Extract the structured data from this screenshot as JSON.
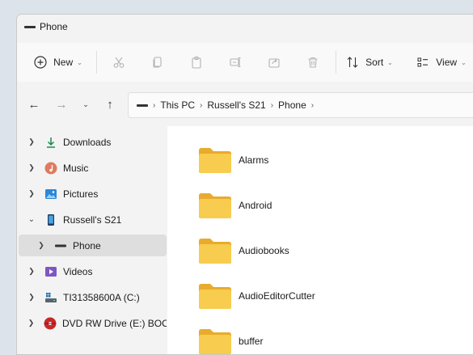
{
  "window": {
    "title": "Phone"
  },
  "toolbar": {
    "new_label": "New",
    "sort_label": "Sort",
    "view_label": "View",
    "buttons": [
      "new",
      "cut",
      "copy",
      "paste",
      "rename",
      "share",
      "delete",
      "sort",
      "view"
    ]
  },
  "address": {
    "crumbs": [
      "This PC",
      "Russell's S21",
      "Phone"
    ]
  },
  "sidebar": {
    "items": [
      {
        "label": "Downloads",
        "icon": "download-icon",
        "expanded": false
      },
      {
        "label": "Music",
        "icon": "music-icon",
        "expanded": false
      },
      {
        "label": "Pictures",
        "icon": "pictures-icon",
        "expanded": false
      },
      {
        "label": "Russell's S21",
        "icon": "phone-device-icon",
        "expanded": true
      },
      {
        "label": "Phone",
        "icon": "phone-storage-icon",
        "expanded": false,
        "selected": true
      },
      {
        "label": "Videos",
        "icon": "videos-icon",
        "expanded": false
      },
      {
        "label": "TI31358600A (C:)",
        "icon": "drive-icon",
        "expanded": false
      },
      {
        "label": "DVD RW Drive (E:) BOOK",
        "icon": "dvd-icon",
        "expanded": false
      }
    ]
  },
  "content": {
    "folders": [
      "Alarms",
      "Android",
      "Audiobooks",
      "AudioEditorCutter",
      "buffer"
    ]
  },
  "colors": {
    "folder": "#f5c842",
    "selection": "#dedede",
    "accent": "#0067c0"
  }
}
